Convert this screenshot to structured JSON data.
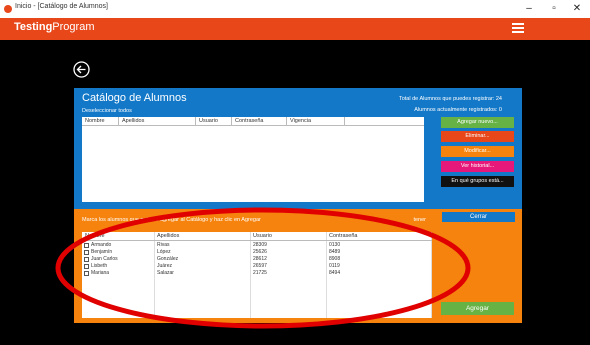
{
  "window": {
    "title": "Inicio - [Catálogo de Alumnos]",
    "controls": {
      "minimize": "–",
      "maximize": "▫",
      "close": "✕"
    }
  },
  "appbar": {
    "brand_bold": "Testing",
    "brand_rest": "Program"
  },
  "catalog": {
    "title": "Catálogo de Alumnos",
    "deselect_all": "Deseleccionar todos",
    "total_label": "Total de Alumnos que puedes registrar: 24",
    "current_label": "Alumnos actualmente registrados:  0",
    "columns": [
      "Nombre",
      "Apellidos",
      "Usuario",
      "Contraseña",
      "Vigencia"
    ]
  },
  "actions": {
    "add_new": "Agregar nuevo...",
    "delete": "Eliminar...",
    "modify": "Modificar...",
    "history": "Ver historial...",
    "groups": "En qué grupos está..."
  },
  "add_panel": {
    "hint": "Marca los alumnos que quieres agregar al Catálogo y haz clic en Agregar",
    "hint_right": "tener",
    "close": "Cerrar",
    "add": "Agregar",
    "columns": [
      "Nombre",
      "Apellidos",
      "Usuario",
      "Contraseña"
    ],
    "rows": [
      {
        "nombre": "Armando",
        "apellidos": "Rivas",
        "usuario": "28309",
        "contrasena": "0130"
      },
      {
        "nombre": "Benjamín",
        "apellidos": "López",
        "usuario": "25626",
        "contrasena": "8489"
      },
      {
        "nombre": "Juan Carlos",
        "apellidos": "González",
        "usuario": "28612",
        "contrasena": "8908"
      },
      {
        "nombre": "Lisbeth",
        "apellidos": "Juárez",
        "usuario": "26597",
        "contrasena": "0119"
      },
      {
        "nombre": "Mariana",
        "apellidos": "Salazar",
        "usuario": "21725",
        "contrasena": "8494"
      }
    ]
  },
  "colors": {
    "orange": "#e8471a",
    "blue": "#1378c8",
    "panel_orange": "#f5830e",
    "green": "#66b245",
    "annotation_red": "#e00000"
  }
}
